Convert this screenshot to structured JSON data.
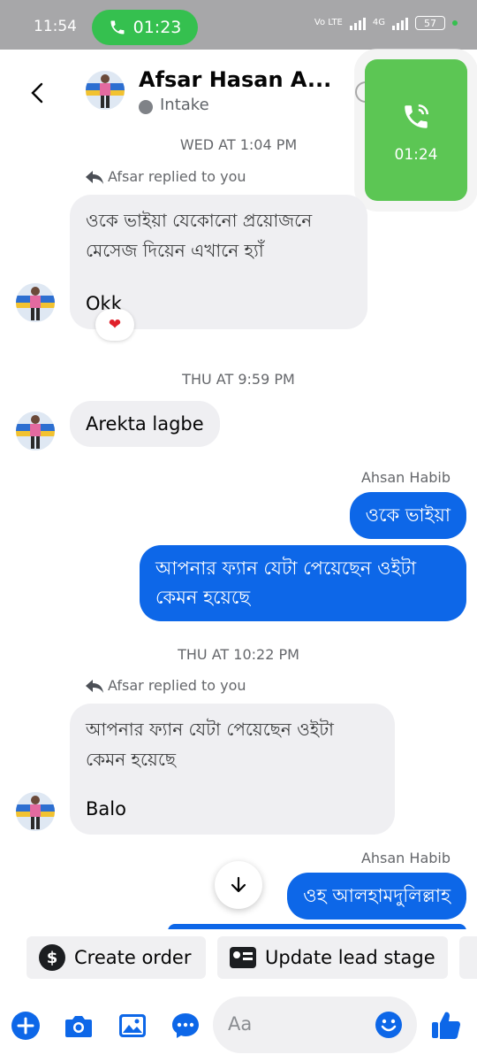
{
  "statusbar": {
    "time": "11:54",
    "call_timer": "01:23",
    "network": "Vo LTE",
    "network2": "4G",
    "battery": "57"
  },
  "header": {
    "contact_name": "Afsar Hasan A...",
    "status": "Intake"
  },
  "call_card": {
    "timer": "01:24"
  },
  "messages": {
    "ts1": "WED AT 1:04 PM",
    "reply_note1": "Afsar replied to you",
    "bubble1_quote": "ওকে ভাইয়া যেকোনো প্রয়োজনে মেসেজ দিয়েন এখানে হ্যাঁ",
    "bubble1_text": "Okk",
    "reaction1": "❤",
    "ts2": "THU AT 9:59 PM",
    "bubble2_text": "Arekta lagbe",
    "sender1": "Ahsan Habib",
    "out1": "ওকে ভাইয়া",
    "out2": "আপনার ফ্যান যেটা পেয়েছেন ওইটা কেমন হয়েছে",
    "ts3": "THU AT 10:22 PM",
    "reply_note2": "Afsar replied to you",
    "bubble3_quote": "আপনার ফ্যান যেটা পেয়েছেন ওইটা কেমন হয়েছে",
    "bubble3_text": "Balo",
    "sender2": "Ahsan Habib",
    "out3": "ওহ আলহামদুলিল্লাহ"
  },
  "quick_actions": {
    "create_order": "Create order",
    "update_lead_stage": "Update lead stage"
  },
  "composer": {
    "placeholder": "Aa"
  },
  "colors": {
    "accent": "#0d67e8",
    "call_green": "#35c04f",
    "incoming_bubble": "#efeff2"
  }
}
